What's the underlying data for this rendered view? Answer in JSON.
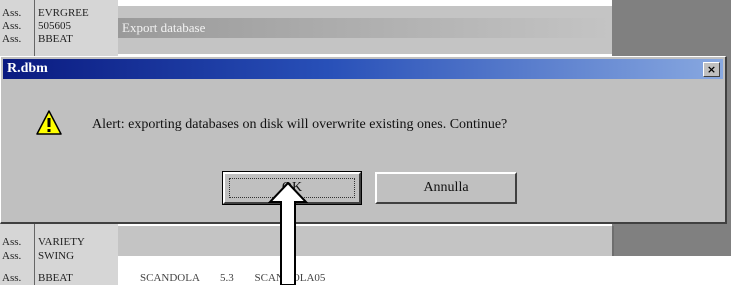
{
  "background": {
    "rows_top": [
      {
        "col1": "Ass.",
        "col2": "EVRGREE"
      },
      {
        "col1": "Ass.",
        "col2": "505605"
      },
      {
        "col1": "Ass.",
        "col2": "BBEAT"
      }
    ],
    "rows_bottom": [
      {
        "col1": "Ass.",
        "col2": "VARIETY"
      },
      {
        "col1": "Ass.",
        "col2": "SWING"
      },
      {
        "col1": "Ass.",
        "col2": "BBEAT"
      }
    ],
    "bottom_strip_text": "SCANDOLA 5.3 SCANDOLA05",
    "export_window_title": "Export database"
  },
  "dialog": {
    "title": "R.dbm",
    "close_label": "×",
    "message": "Alert: exporting databases on disk will overwrite existing ones. Continue?",
    "icon": "warning-icon",
    "ok_label": "OK",
    "cancel_label": "Annulla"
  },
  "colors": {
    "titlebar_start": "#0a1a80",
    "titlebar_end": "#88a8e0",
    "dialog_bg": "#c0c0c0",
    "warning_yellow": "#ffff00"
  }
}
